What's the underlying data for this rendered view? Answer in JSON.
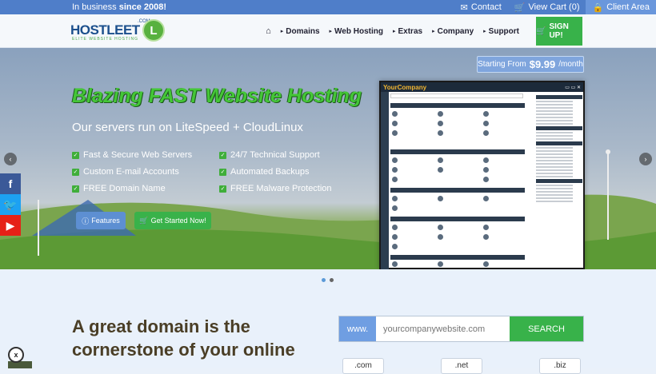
{
  "topbar": {
    "tagline_prefix": "In business",
    "tagline_bold": "since 2008!",
    "contact": "Contact",
    "cart": "View Cart (0)",
    "client_area": "Client Area"
  },
  "logo": {
    "text": "HOSTLEET",
    "suffix": ".COM",
    "subtitle": "ELITE WEBSITE HOSTING",
    "mark": "L"
  },
  "nav": {
    "home_icon": "home-icon",
    "items": [
      "Domains",
      "Web Hosting",
      "Extras",
      "Company",
      "Support"
    ],
    "signup": "SIGN UP!"
  },
  "hero": {
    "starting_label": "Starting From",
    "price": "$9.99",
    "per": "/month",
    "headline": "Blazing FAST Website Hosting",
    "subhead": "Our servers run on LiteSpeed + CloudLinux",
    "features_left": [
      "Fast & Secure Web Servers",
      "Custom E-mail Accounts",
      "FREE Domain Name"
    ],
    "features_right": [
      "24/7 Technical Support",
      "Automated Backups",
      "FREE Malware Protection"
    ],
    "btn_features": "Features",
    "btn_start": "Get Started Now!",
    "cpanel_brand": "YourCompany"
  },
  "slider": {
    "dot_count": 2,
    "active_index": 0
  },
  "social": [
    "facebook-icon",
    "twitter-icon",
    "youtube-icon"
  ],
  "domain_section": {
    "title_line1": "A great domain is the",
    "title_line2": "cornerstone of your online",
    "prefix": "www.",
    "placeholder": "yourcompanywebsite.com",
    "search_button": "SEARCH",
    "tlds": [
      ".com",
      ".net",
      ".biz"
    ]
  },
  "colors": {
    "topbar": "#4f7ec9",
    "green": "#38b24a",
    "blue_accent": "#6f9ee2"
  }
}
